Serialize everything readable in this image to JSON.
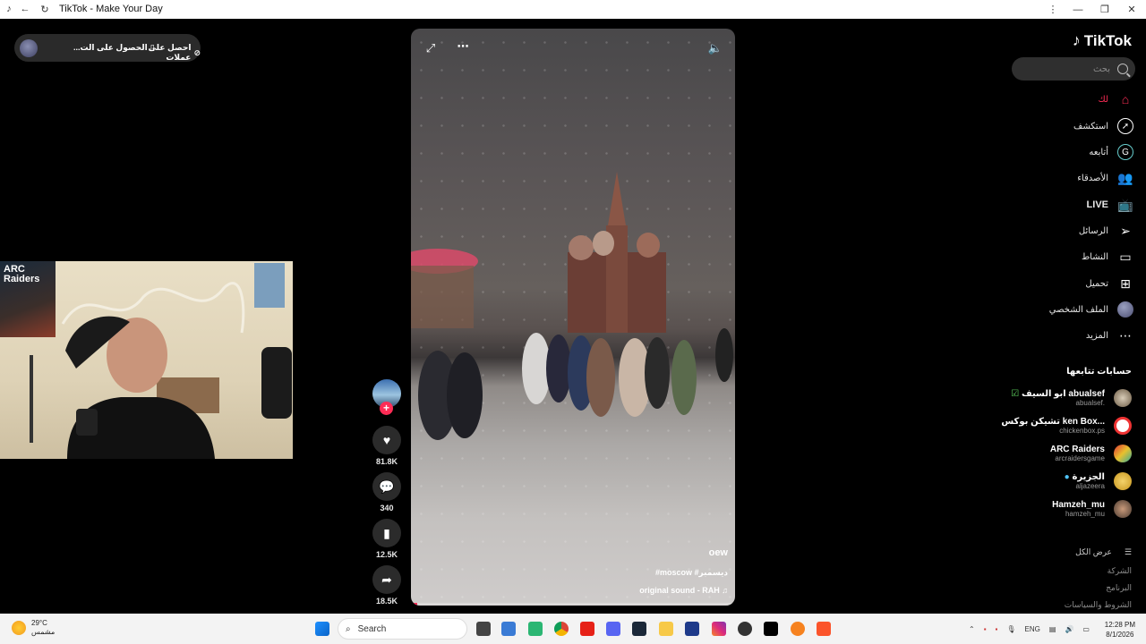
{
  "browser": {
    "title": "TikTok - Make Your Day",
    "back_icon": "back-arrow-icon",
    "reload_icon": "reload-icon"
  },
  "top_pill": {
    "item1_label": "احصل على عملات",
    "item2_label": "الحصول على الت..."
  },
  "sidebar": {
    "logo_text": "TikTok",
    "search_placeholder": "بحث",
    "nav": [
      {
        "label": "لك",
        "icon": "home-icon"
      },
      {
        "label": "استكشف",
        "icon": "compass-icon"
      },
      {
        "label": "أتابعه",
        "icon": "following-icon"
      },
      {
        "label": "الأصدقاء",
        "icon": "friends-icon"
      },
      {
        "label": "LIVE",
        "icon": "live-icon"
      },
      {
        "label": "الرسائل",
        "icon": "send-icon"
      },
      {
        "label": "النشاط",
        "icon": "activity-icon"
      },
      {
        "label": "تحميل",
        "icon": "upload-icon"
      },
      {
        "label": "الملف الشخصي",
        "icon": "profile-avatar"
      },
      {
        "label": "المزيد",
        "icon": "more-icon"
      }
    ],
    "following_title": "حسابات تتابعها",
    "accounts": [
      {
        "name": "ابو السيف abualsef",
        "handle": "abualsef."
      },
      {
        "name": "تشيكن بوكس Chicken Box",
        "name_display": "تشيكن بوكس ken Box...",
        "handle": "chickenbox.ps"
      },
      {
        "name": "ARC Raiders",
        "handle": "arcraidersgame"
      },
      {
        "name": "الجزيرة",
        "handle": "aljazeera"
      },
      {
        "name": "Hamzeh_mu",
        "handle": "hamzeh_mu"
      }
    ],
    "see_all": "عرض الكل",
    "footer": [
      "الشركة",
      "البرنامج",
      "الشروط والسياسات"
    ]
  },
  "video": {
    "hashtags": "#moscow #ديسمبر",
    "sound": "original sound - RAH",
    "watermark": "oew",
    "progress": 0.02
  },
  "actions": {
    "likes": "81.8K",
    "comments": "340",
    "saves": "12.5K",
    "shares": "18.5K"
  },
  "webcam": {
    "poster_text": "ARC Raiders"
  },
  "taskbar": {
    "temperature": "29°C",
    "weather": "مشمس",
    "search_label": "Search",
    "language": "ENG",
    "time": "12:28 PM",
    "date": "8/1/2026"
  },
  "colors": {
    "accent": "#fe2c55",
    "background": "#000000",
    "nav_text": "#e8e8e8"
  }
}
